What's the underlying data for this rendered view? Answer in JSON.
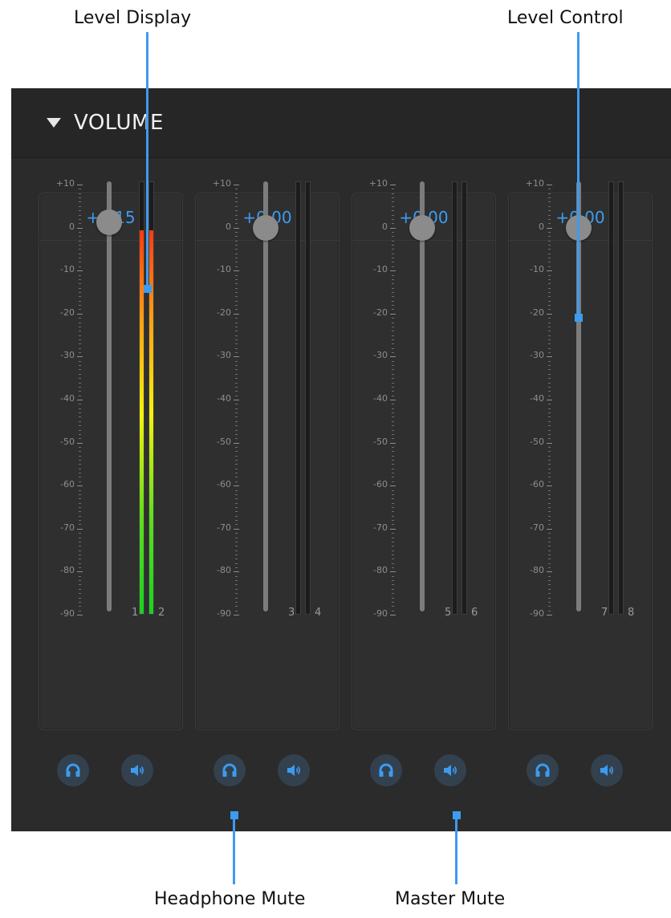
{
  "callouts": {
    "level_display": "Level Display",
    "level_control": "Level Control",
    "headphone_mute": "Headphone Mute",
    "master_mute": "Master Mute"
  },
  "panel": {
    "title": "VOLUME",
    "collapse_icon": "triangle-down-icon"
  },
  "scale": {
    "labels": [
      "+10",
      "0",
      "-10",
      "-20",
      "-30",
      "-40",
      "-50",
      "-60",
      "-70",
      "-80",
      "-90"
    ]
  },
  "channels": [
    {
      "value": "+1.15",
      "fader_db": 1.15,
      "meter_left": "1",
      "meter_right": "2",
      "meter_level_db": -0.5
    },
    {
      "value": "+0.00",
      "fader_db": 0.0,
      "meter_left": "3",
      "meter_right": "4",
      "meter_level_db": null
    },
    {
      "value": "+0.00",
      "fader_db": 0.0,
      "meter_left": "5",
      "meter_right": "6",
      "meter_level_db": null
    },
    {
      "value": "+0.00",
      "fader_db": 0.0,
      "meter_left": "7",
      "meter_right": "8",
      "meter_level_db": null
    }
  ],
  "buttons": {
    "headphone_icon": "headphone-icon",
    "speaker_icon": "speaker-icon"
  },
  "colors": {
    "accent": "#3d9bf0",
    "panel_bg": "#2b2b2b",
    "meter_green": "#19d122",
    "meter_yellow": "#f4f20d",
    "meter_red": "#ff3a0e"
  }
}
